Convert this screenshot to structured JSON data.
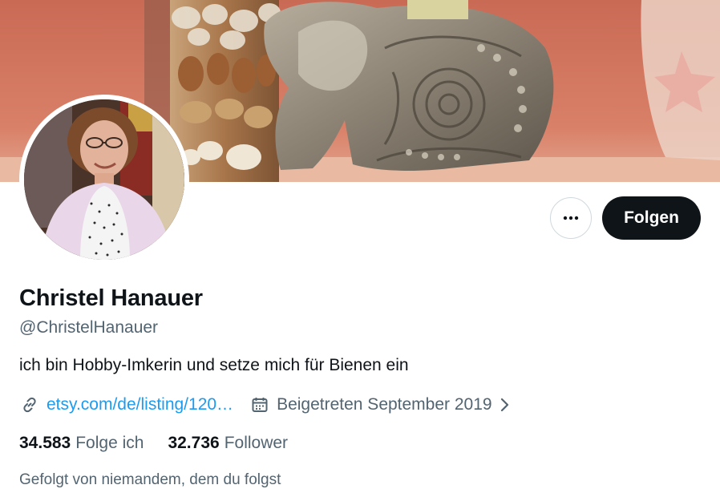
{
  "profile": {
    "display_name": "Christel Hanauer",
    "handle": "@ChristelHanauer",
    "bio": "ich bin Hobby-Imkerin und setze mich für Bienen ein",
    "website": "etsy.com/de/listing/120…",
    "joined": "Beigetreten September 2019",
    "following_count": "34.583",
    "following_label": "Folge ich",
    "followers_count": "32.736",
    "followers_label": "Follower",
    "followed_by_text": "Gefolgt von niemandem, dem du folgst"
  },
  "actions": {
    "follow_label": "Folgen",
    "more_icon": "more-horizontal-icon"
  },
  "icons": {
    "website": "link-icon",
    "joined": "calendar-icon",
    "expand": "chevron-right-icon"
  },
  "colors": {
    "text_primary": "#0f1419",
    "text_secondary": "#536471",
    "link": "#1d9bf0",
    "follow_button_bg": "#0f1419",
    "border": "#cfd9de"
  }
}
